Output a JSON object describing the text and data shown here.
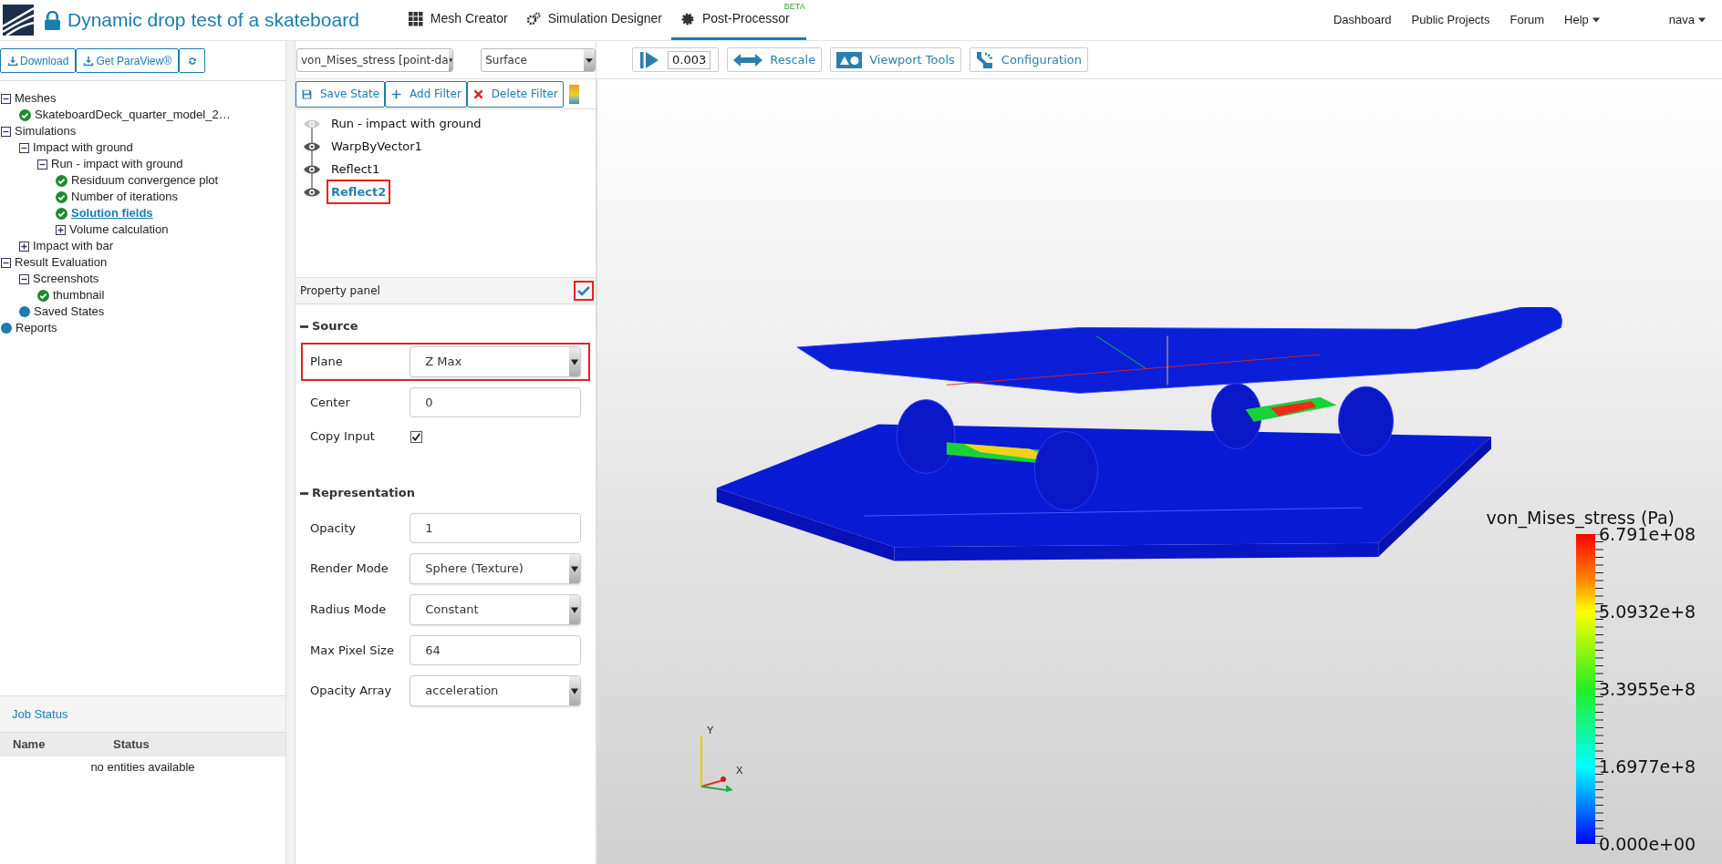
{
  "header": {
    "title": "Dynamic drop test of a skateboard",
    "nav": [
      {
        "label": "Mesh Creator",
        "selected": false
      },
      {
        "label": "Simulation Designer",
        "selected": false
      },
      {
        "label": "Post-Processor",
        "selected": true,
        "badge": "BETA"
      }
    ],
    "links": [
      {
        "label": "Dashboard",
        "dropdown": false
      },
      {
        "label": "Public Projects",
        "dropdown": false
      },
      {
        "label": "Forum",
        "dropdown": false
      },
      {
        "label": "Help",
        "dropdown": true
      }
    ],
    "user": "nava"
  },
  "sidebar": {
    "buttons": [
      {
        "label": "Download"
      },
      {
        "label": "Get ParaView®"
      }
    ],
    "tree": [
      {
        "label": "Meshes",
        "kind": "group",
        "expanded": true,
        "selected": false,
        "children": [
          {
            "label": "SkateboardDeck_quarter_model_2…",
            "kind": "done",
            "selected": false
          }
        ]
      },
      {
        "label": "Simulations",
        "kind": "group",
        "expanded": true,
        "selected": false,
        "children": [
          {
            "label": "Impact with ground",
            "kind": "group",
            "expanded": true,
            "selected": false,
            "children": [
              {
                "label": "Run - impact with ground",
                "kind": "group",
                "expanded": true,
                "selected": false,
                "children": [
                  {
                    "label": "Residuum convergence plot",
                    "kind": "done",
                    "selected": false
                  },
                  {
                    "label": "Number of iterations",
                    "kind": "done",
                    "selected": false
                  },
                  {
                    "label": "Solution fields",
                    "kind": "done",
                    "selected": true
                  },
                  {
                    "label": "Volume calculation",
                    "kind": "group",
                    "expanded": false,
                    "selected": false
                  }
                ]
              }
            ]
          },
          {
            "label": "Impact with bar",
            "kind": "group",
            "expanded": false,
            "selected": false
          }
        ]
      },
      {
        "label": "Result Evaluation",
        "kind": "group",
        "expanded": true,
        "selected": false,
        "children": [
          {
            "label": "Screenshots",
            "kind": "group",
            "expanded": true,
            "selected": false,
            "children": [
              {
                "label": "thumbnail",
                "kind": "done",
                "selected": false
              }
            ]
          },
          {
            "label": "Saved States",
            "kind": "dot",
            "selected": false
          }
        ]
      },
      {
        "label": "Reports",
        "kind": "dot",
        "selected": false
      }
    ],
    "job_status": {
      "title": "Job Status",
      "columns": [
        "Name",
        "Status"
      ],
      "empty": "no entities available"
    }
  },
  "pipeline": {
    "field_select": "von_Mises_stress [point-da",
    "repr_select": "Surface",
    "buttons": [
      {
        "label": "Save State"
      },
      {
        "label": "Add Filter"
      },
      {
        "label": "Delete Filter"
      }
    ],
    "filters": [
      {
        "label": "Run - impact with ground",
        "visible": false,
        "selected": false
      },
      {
        "label": "WarpByVector1",
        "visible": true,
        "selected": false
      },
      {
        "label": "Reflect1",
        "visible": true,
        "selected": false
      },
      {
        "label": "Reflect2",
        "visible": true,
        "selected": true
      }
    ],
    "property_panel": {
      "title": "Property panel",
      "checked": true,
      "sections": [
        {
          "title": "Source",
          "expanded": true,
          "props": [
            {
              "label": "Plane",
              "kind": "select",
              "value": "Z Max",
              "highlighted": true
            },
            {
              "label": "Center",
              "kind": "input",
              "value": "0",
              "highlighted": false
            },
            {
              "label": "Copy Input",
              "kind": "checkbox",
              "checked": true,
              "highlighted": false
            }
          ]
        },
        {
          "title": "Representation",
          "expanded": true,
          "props": [
            {
              "label": "Opacity",
              "kind": "input",
              "value": "1",
              "highlighted": false
            },
            {
              "label": "Render Mode",
              "kind": "select",
              "value": "Sphere (Texture)",
              "highlighted": false
            },
            {
              "label": "Radius Mode",
              "kind": "select",
              "value": "Constant",
              "highlighted": false
            },
            {
              "label": "Max Pixel Size",
              "kind": "input",
              "value": "64",
              "highlighted": false
            },
            {
              "label": "Opacity Array",
              "kind": "select",
              "value": "acceleration",
              "highlighted": false
            }
          ]
        }
      ]
    }
  },
  "viewport": {
    "toolbar": [
      {
        "kind": "time",
        "value": "0.003"
      },
      {
        "kind": "button",
        "label": "Rescale"
      },
      {
        "kind": "button",
        "label": "Viewport Tools"
      },
      {
        "kind": "button",
        "label": "Configuration"
      }
    ],
    "legend": {
      "title": "von_Mises_stress (Pa)",
      "labels": [
        "6.791e+08",
        "5.0932e+8",
        "3.3955e+8",
        "1.6977e+8",
        "0.000e+00"
      ]
    },
    "axes": {
      "y": "Y",
      "x": "X"
    }
  }
}
